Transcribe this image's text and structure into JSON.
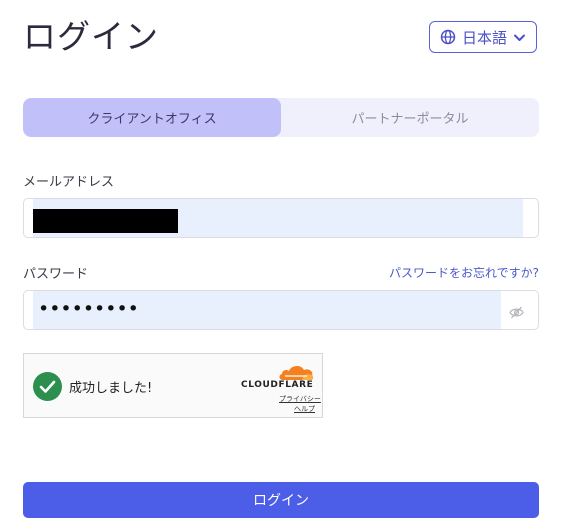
{
  "page": {
    "title": "ログイン"
  },
  "language": {
    "label": "日本語",
    "icon": "globe-icon"
  },
  "tabs": [
    {
      "label": "クライアントオフィス",
      "active": true
    },
    {
      "label": "パートナーポータル",
      "active": false
    }
  ],
  "form": {
    "email_label": "メールアドレス",
    "password_label": "パスワード",
    "forgot_link": "パスワードをお忘れですか?",
    "password_value": "•••••••••"
  },
  "captcha": {
    "status_text": "成功しました!",
    "brand": "CLOUDFLARE",
    "privacy_link": "プライバシー",
    "help_link": "ヘルプ"
  },
  "submit": {
    "label": "ログイン"
  },
  "colors": {
    "accent": "#4c5de8",
    "tab_active": "#c2c0f8",
    "success": "#2d8f4e",
    "cloudflare_orange": "#f48120"
  }
}
